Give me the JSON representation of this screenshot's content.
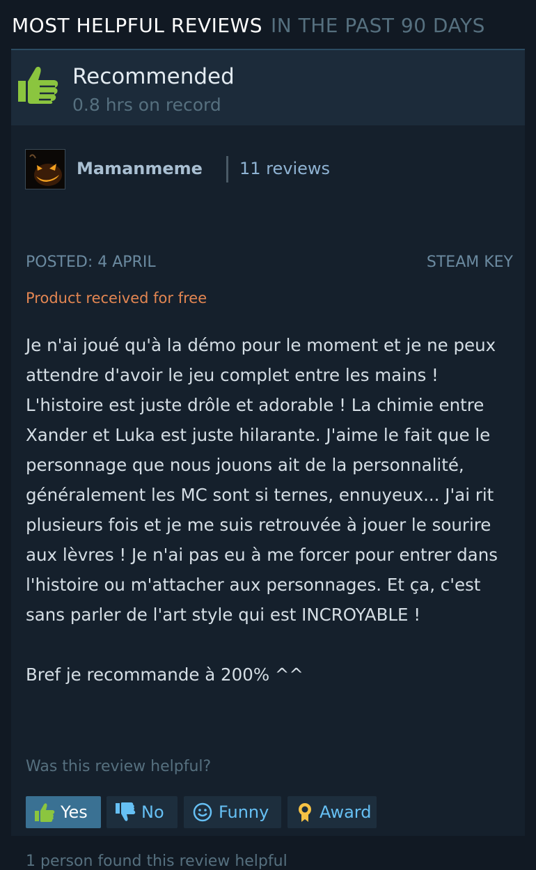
{
  "section": {
    "title": "MOST HELPFUL REVIEWS",
    "subtitle": "IN THE PAST 90 DAYS"
  },
  "review": {
    "vote": "Recommended",
    "hours": "0.8 hrs on record",
    "author": {
      "name": "Mamanmeme",
      "review_count": "11 reviews",
      "avatar_icon": "jack-o-lantern-avatar"
    },
    "posted": "POSTED: 4 APRIL",
    "source": "STEAM KEY",
    "free_notice": "Product received for free",
    "body": [
      "Je n'ai joué qu'à la démo pour le moment et je ne peux attendre d'avoir le jeu complet entre les mains ! L'histoire est juste drôle et adorable ! La chimie entre Xander et Luka est juste hilarante. J'aime le fait que le personnage que nous jouons ait de la personnalité, généralement les MC sont si ternes, ennuyeux... J'ai rit plusieurs fois et je me suis retrouvée à jouer le sourire aux lèvres ! Je n'ai pas eu à me forcer pour entrer dans l'histoire ou m'attacher aux personnages. Et ça, c'est sans parler de l'art style qui est INCROYABLE !",
      "Bref je recommande à 200% ^^"
    ],
    "helpful_question": "Was this review helpful?",
    "buttons": {
      "yes": "Yes",
      "no": "No",
      "funny": "Funny",
      "award": "Award"
    },
    "found_helpful": "1 person found this review helpful"
  },
  "colors": {
    "background": "#111923",
    "card": "#15202c",
    "header_bar": "#1c2b3a",
    "recommend_green": "#8bc53f",
    "link_blue": "#66c0f4",
    "free_orange": "#e38652",
    "yes_active": "#3a7193"
  }
}
